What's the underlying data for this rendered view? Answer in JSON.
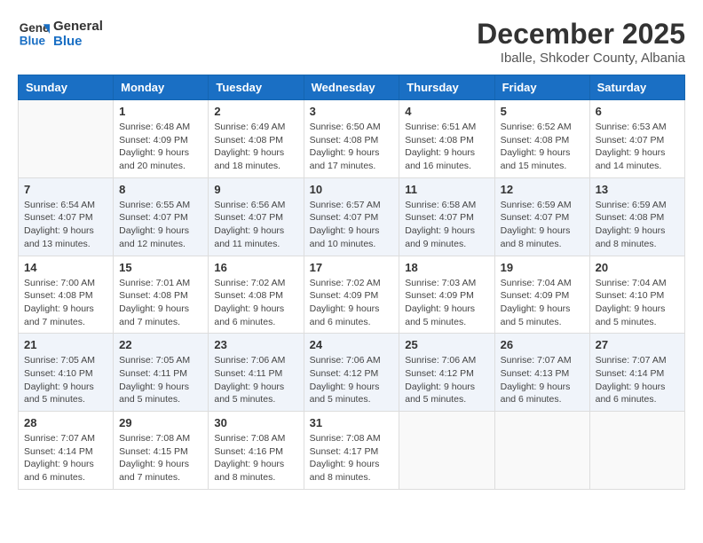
{
  "header": {
    "logo_line1": "General",
    "logo_line2": "Blue",
    "month_title": "December 2025",
    "subtitle": "Iballe, Shkoder County, Albania"
  },
  "weekdays": [
    "Sunday",
    "Monday",
    "Tuesday",
    "Wednesday",
    "Thursday",
    "Friday",
    "Saturday"
  ],
  "weeks": [
    [
      {
        "day": "",
        "info": ""
      },
      {
        "day": "1",
        "info": "Sunrise: 6:48 AM\nSunset: 4:09 PM\nDaylight: 9 hours\nand 20 minutes."
      },
      {
        "day": "2",
        "info": "Sunrise: 6:49 AM\nSunset: 4:08 PM\nDaylight: 9 hours\nand 18 minutes."
      },
      {
        "day": "3",
        "info": "Sunrise: 6:50 AM\nSunset: 4:08 PM\nDaylight: 9 hours\nand 17 minutes."
      },
      {
        "day": "4",
        "info": "Sunrise: 6:51 AM\nSunset: 4:08 PM\nDaylight: 9 hours\nand 16 minutes."
      },
      {
        "day": "5",
        "info": "Sunrise: 6:52 AM\nSunset: 4:08 PM\nDaylight: 9 hours\nand 15 minutes."
      },
      {
        "day": "6",
        "info": "Sunrise: 6:53 AM\nSunset: 4:07 PM\nDaylight: 9 hours\nand 14 minutes."
      }
    ],
    [
      {
        "day": "7",
        "info": "Sunrise: 6:54 AM\nSunset: 4:07 PM\nDaylight: 9 hours\nand 13 minutes."
      },
      {
        "day": "8",
        "info": "Sunrise: 6:55 AM\nSunset: 4:07 PM\nDaylight: 9 hours\nand 12 minutes."
      },
      {
        "day": "9",
        "info": "Sunrise: 6:56 AM\nSunset: 4:07 PM\nDaylight: 9 hours\nand 11 minutes."
      },
      {
        "day": "10",
        "info": "Sunrise: 6:57 AM\nSunset: 4:07 PM\nDaylight: 9 hours\nand 10 minutes."
      },
      {
        "day": "11",
        "info": "Sunrise: 6:58 AM\nSunset: 4:07 PM\nDaylight: 9 hours\nand 9 minutes."
      },
      {
        "day": "12",
        "info": "Sunrise: 6:59 AM\nSunset: 4:07 PM\nDaylight: 9 hours\nand 8 minutes."
      },
      {
        "day": "13",
        "info": "Sunrise: 6:59 AM\nSunset: 4:08 PM\nDaylight: 9 hours\nand 8 minutes."
      }
    ],
    [
      {
        "day": "14",
        "info": "Sunrise: 7:00 AM\nSunset: 4:08 PM\nDaylight: 9 hours\nand 7 minutes."
      },
      {
        "day": "15",
        "info": "Sunrise: 7:01 AM\nSunset: 4:08 PM\nDaylight: 9 hours\nand 7 minutes."
      },
      {
        "day": "16",
        "info": "Sunrise: 7:02 AM\nSunset: 4:08 PM\nDaylight: 9 hours\nand 6 minutes."
      },
      {
        "day": "17",
        "info": "Sunrise: 7:02 AM\nSunset: 4:09 PM\nDaylight: 9 hours\nand 6 minutes."
      },
      {
        "day": "18",
        "info": "Sunrise: 7:03 AM\nSunset: 4:09 PM\nDaylight: 9 hours\nand 5 minutes."
      },
      {
        "day": "19",
        "info": "Sunrise: 7:04 AM\nSunset: 4:09 PM\nDaylight: 9 hours\nand 5 minutes."
      },
      {
        "day": "20",
        "info": "Sunrise: 7:04 AM\nSunset: 4:10 PM\nDaylight: 9 hours\nand 5 minutes."
      }
    ],
    [
      {
        "day": "21",
        "info": "Sunrise: 7:05 AM\nSunset: 4:10 PM\nDaylight: 9 hours\nand 5 minutes."
      },
      {
        "day": "22",
        "info": "Sunrise: 7:05 AM\nSunset: 4:11 PM\nDaylight: 9 hours\nand 5 minutes."
      },
      {
        "day": "23",
        "info": "Sunrise: 7:06 AM\nSunset: 4:11 PM\nDaylight: 9 hours\nand 5 minutes."
      },
      {
        "day": "24",
        "info": "Sunrise: 7:06 AM\nSunset: 4:12 PM\nDaylight: 9 hours\nand 5 minutes."
      },
      {
        "day": "25",
        "info": "Sunrise: 7:06 AM\nSunset: 4:12 PM\nDaylight: 9 hours\nand 5 minutes."
      },
      {
        "day": "26",
        "info": "Sunrise: 7:07 AM\nSunset: 4:13 PM\nDaylight: 9 hours\nand 6 minutes."
      },
      {
        "day": "27",
        "info": "Sunrise: 7:07 AM\nSunset: 4:14 PM\nDaylight: 9 hours\nand 6 minutes."
      }
    ],
    [
      {
        "day": "28",
        "info": "Sunrise: 7:07 AM\nSunset: 4:14 PM\nDaylight: 9 hours\nand 6 minutes."
      },
      {
        "day": "29",
        "info": "Sunrise: 7:08 AM\nSunset: 4:15 PM\nDaylight: 9 hours\nand 7 minutes."
      },
      {
        "day": "30",
        "info": "Sunrise: 7:08 AM\nSunset: 4:16 PM\nDaylight: 9 hours\nand 8 minutes."
      },
      {
        "day": "31",
        "info": "Sunrise: 7:08 AM\nSunset: 4:17 PM\nDaylight: 9 hours\nand 8 minutes."
      },
      {
        "day": "",
        "info": ""
      },
      {
        "day": "",
        "info": ""
      },
      {
        "day": "",
        "info": ""
      }
    ]
  ]
}
